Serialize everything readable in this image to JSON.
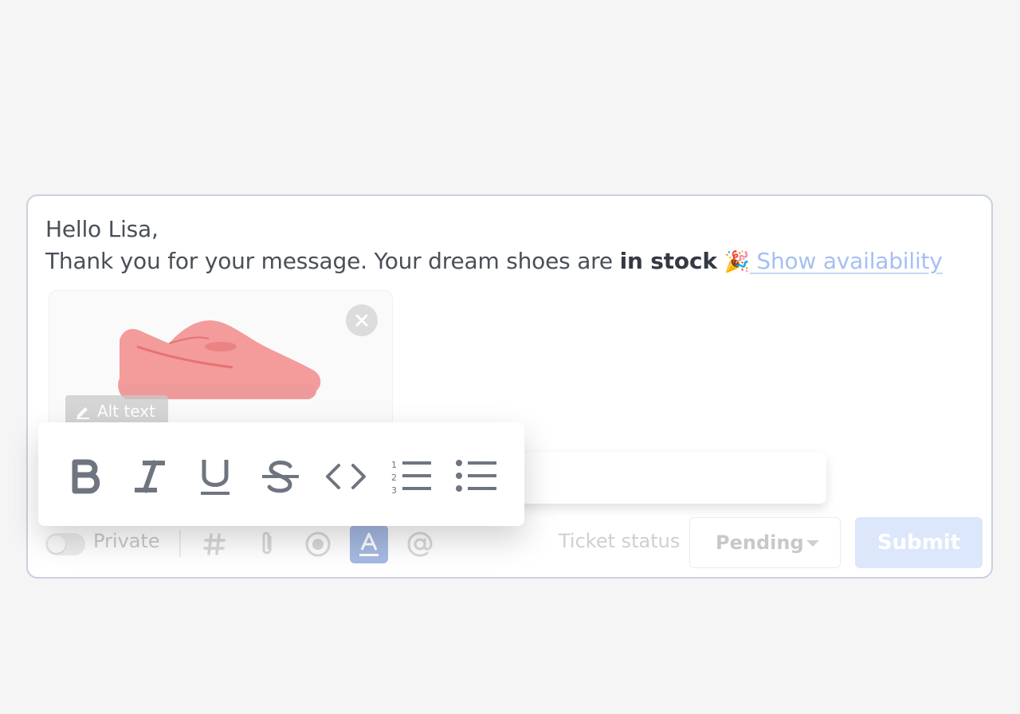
{
  "message": {
    "greeting": "Hello Lisa,",
    "line2_prefix": "Thank you for your message.  Your dream shoes are ",
    "line2_bold": "in stock",
    "emoji": "🎉",
    "link_text": " Show availability"
  },
  "image_card": {
    "alt_button_label": "Alt text",
    "close_icon": "close-circle-icon"
  },
  "toolbar": {
    "private_label": "Private",
    "icons": [
      "hashtag-icon",
      "paperclip-icon",
      "record-icon",
      "text-format-icon",
      "mention-icon"
    ],
    "status_label": "Ticket status",
    "status_value": "Pending",
    "submit_label": "Submit"
  },
  "format_toolbar": {
    "buttons": [
      "bold-icon",
      "italic-icon",
      "underline-icon",
      "strikethrough-icon",
      "code-icon",
      "ordered-list-icon",
      "bullet-list-icon"
    ]
  },
  "colors": {
    "link": "#a6bff2",
    "submit_bg": "#dde7fb",
    "active_tool_bg": "#a5b9e2",
    "icon_gray": "#6f7580"
  }
}
